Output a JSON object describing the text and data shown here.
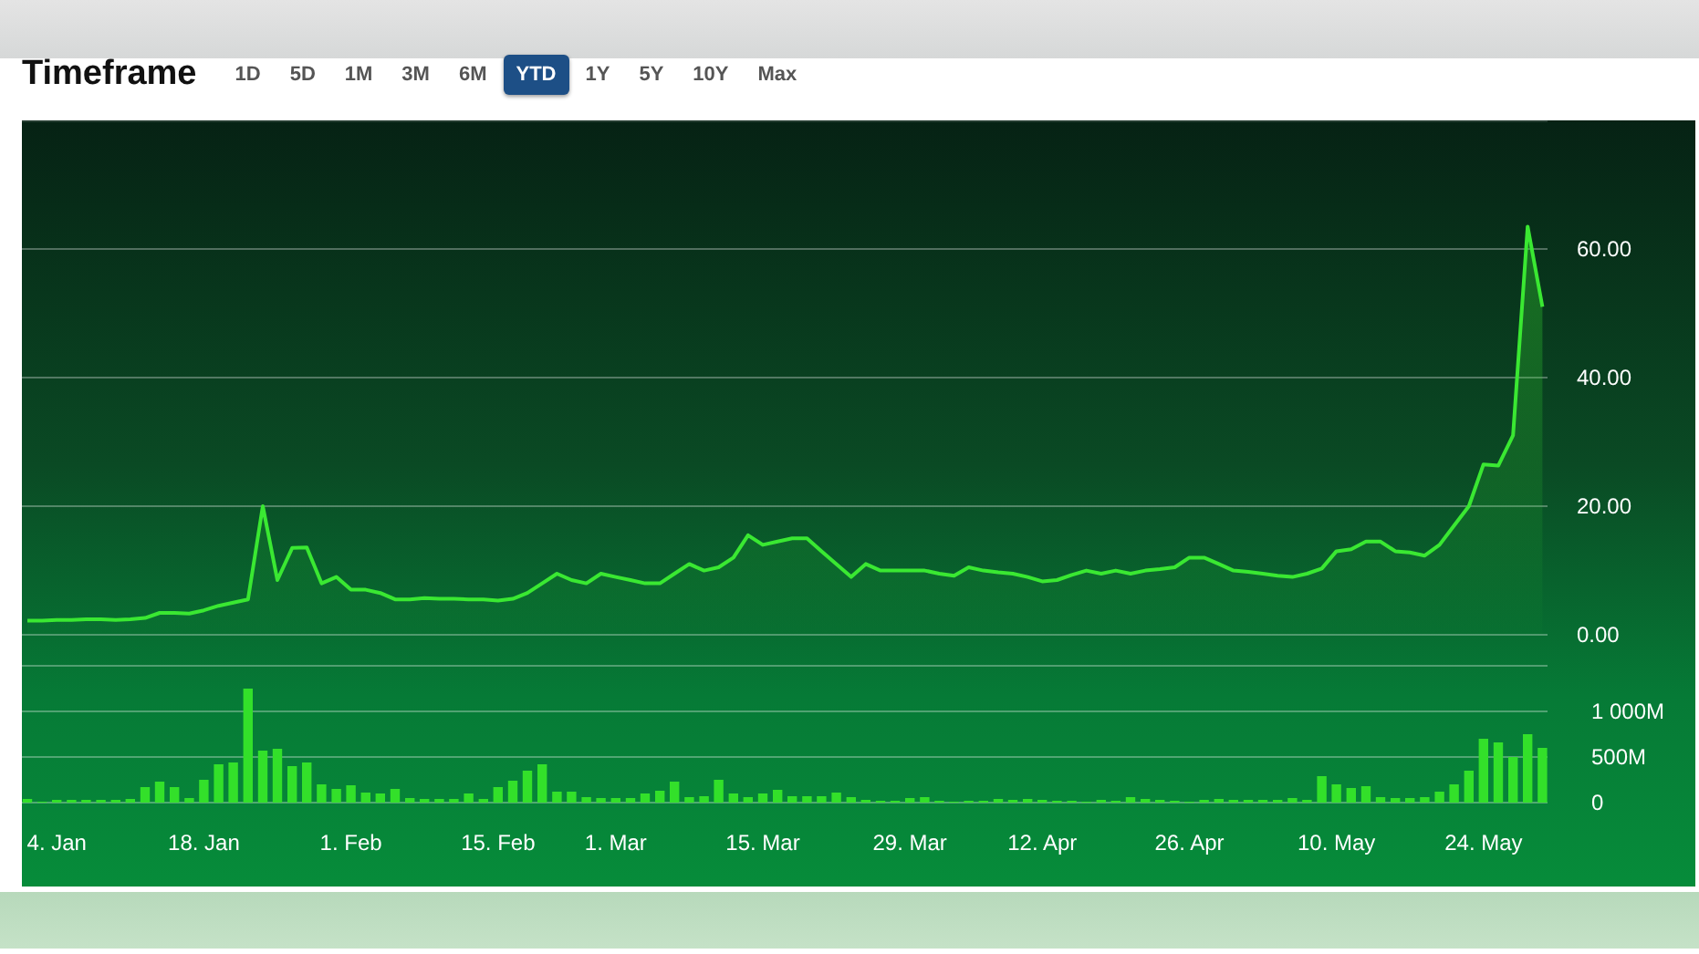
{
  "timeframe": {
    "title": "Timeframe",
    "options": [
      {
        "label": "1D",
        "selected": false
      },
      {
        "label": "5D",
        "selected": false
      },
      {
        "label": "1M",
        "selected": false
      },
      {
        "label": "3M",
        "selected": false
      },
      {
        "label": "6M",
        "selected": false
      },
      {
        "label": "YTD",
        "selected": true
      },
      {
        "label": "1Y",
        "selected": false
      },
      {
        "label": "5Y",
        "selected": false
      },
      {
        "label": "10Y",
        "selected": false
      },
      {
        "label": "Max",
        "selected": false
      }
    ]
  },
  "price_chart": {
    "chart_data": {
      "type": "area",
      "grid": true,
      "ylim": [
        0,
        80
      ],
      "yticks": [
        {
          "value": 0,
          "label": "0.00"
        },
        {
          "value": 20,
          "label": "20.00"
        },
        {
          "value": 40,
          "label": "40.00"
        },
        {
          "value": 60,
          "label": "60.00"
        }
      ],
      "series": [
        {
          "color": "#3ae832",
          "values": [
            2.2,
            2.2,
            2.3,
            2.3,
            2.4,
            2.4,
            2.3,
            2.4,
            2.6,
            3.4,
            3.4,
            3.3,
            3.8,
            4.5,
            5.0,
            5.5,
            20.0,
            8.5,
            13.5,
            13.6,
            8.0,
            9.0,
            7.0,
            7.0,
            6.5,
            5.5,
            5.5,
            5.7,
            5.6,
            5.6,
            5.5,
            5.5,
            5.3,
            5.6,
            6.5,
            8.0,
            9.5,
            8.5,
            8.0,
            9.5,
            9.0,
            8.5,
            8.0,
            8.0,
            9.5,
            11.0,
            10.0,
            10.5,
            12.0,
            15.5,
            14.0,
            14.5,
            15.0,
            15.0,
            13.0,
            11.0,
            9.0,
            11.0,
            10.0,
            10.0,
            10.0,
            10.0,
            9.5,
            9.2,
            10.5,
            10.0,
            9.7,
            9.5,
            9.0,
            8.3,
            8.5,
            9.3,
            10.0,
            9.5,
            10.0,
            9.5,
            10.0,
            10.2,
            10.5,
            12.0,
            12.0,
            11.0,
            10.0,
            9.8,
            9.5,
            9.2,
            9.0,
            9.5,
            10.3,
            13.0,
            13.3,
            14.5,
            14.5,
            13.0,
            12.8,
            12.3,
            14.0,
            17.0,
            20.0,
            26.5,
            26.3,
            31.0,
            63.5,
            51.0
          ]
        }
      ]
    }
  },
  "volume_chart": {
    "chart_data": {
      "type": "bar",
      "grid": true,
      "categories": [
        null,
        null,
        "4. Jan",
        null,
        null,
        null,
        null,
        null,
        null,
        null,
        null,
        null,
        "18. Jan",
        null,
        null,
        null,
        null,
        null,
        null,
        null,
        null,
        null,
        "1. Feb",
        null,
        null,
        null,
        null,
        null,
        null,
        null,
        null,
        null,
        "15. Feb",
        null,
        null,
        null,
        null,
        null,
        null,
        null,
        "1. Mar",
        null,
        null,
        null,
        null,
        null,
        null,
        null,
        null,
        null,
        "15. Mar",
        null,
        null,
        null,
        null,
        null,
        null,
        null,
        null,
        null,
        "29. Mar",
        null,
        null,
        null,
        null,
        null,
        null,
        null,
        null,
        "12. Apr",
        null,
        null,
        null,
        null,
        null,
        null,
        null,
        null,
        null,
        "26. Apr",
        null,
        null,
        null,
        null,
        null,
        null,
        null,
        null,
        null,
        "10. May",
        null,
        null,
        null,
        null,
        null,
        null,
        null,
        null,
        null,
        "24. May",
        null,
        null,
        null,
        null
      ],
      "ylim": [
        0,
        1500
      ],
      "yticks": [
        {
          "value": 0,
          "label": "0"
        },
        {
          "value": 500,
          "label": "500M"
        },
        {
          "value": 1000,
          "label": "1 000M"
        }
      ],
      "series": [
        {
          "color": "#33e02a",
          "values": [
            40,
            10,
            30,
            30,
            30,
            30,
            30,
            40,
            170,
            230,
            170,
            50,
            250,
            420,
            440,
            1250,
            570,
            590,
            400,
            440,
            200,
            150,
            190,
            110,
            100,
            150,
            50,
            40,
            40,
            40,
            100,
            40,
            170,
            240,
            350,
            420,
            120,
            120,
            60,
            50,
            50,
            50,
            100,
            130,
            230,
            60,
            70,
            250,
            100,
            60,
            100,
            140,
            70,
            70,
            70,
            110,
            60,
            30,
            20,
            20,
            50,
            60,
            20,
            10,
            20,
            20,
            40,
            30,
            40,
            30,
            20,
            20,
            10,
            30,
            20,
            60,
            40,
            30,
            20,
            10,
            30,
            40,
            30,
            30,
            30,
            30,
            50,
            30,
            290,
            200,
            160,
            180,
            60,
            50,
            50,
            60,
            120,
            200,
            350,
            700,
            660,
            500,
            750,
            600
          ]
        }
      ]
    }
  }
}
